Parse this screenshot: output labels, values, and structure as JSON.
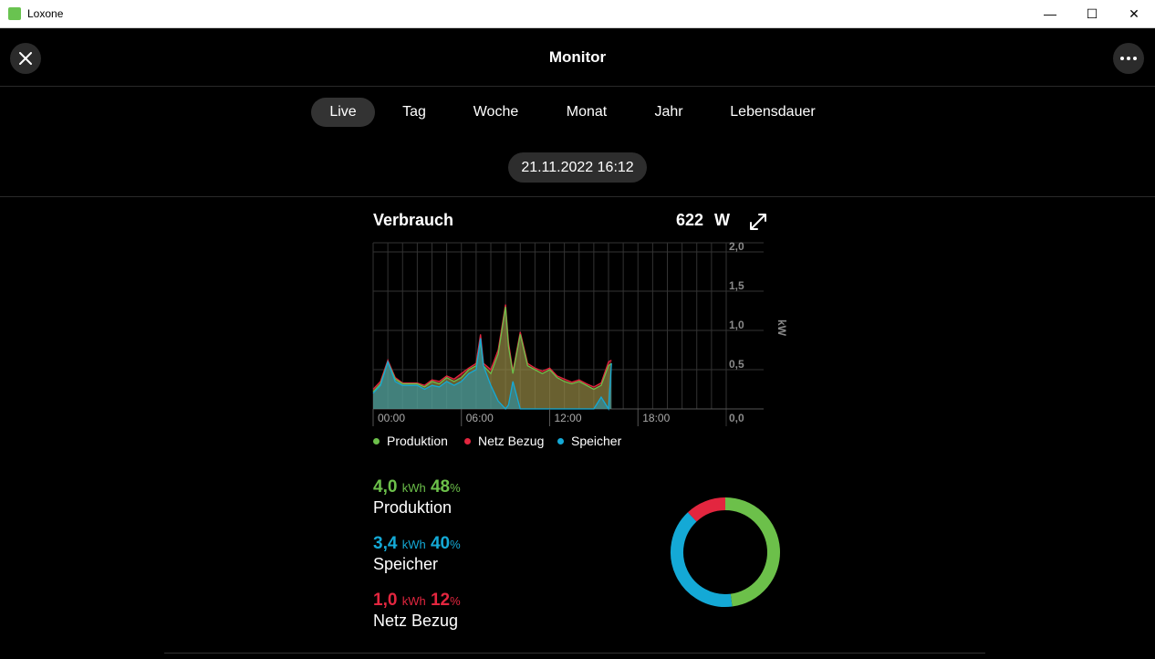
{
  "window": {
    "title": "Loxone",
    "min": "—",
    "max": "☐",
    "close": "✕"
  },
  "header": {
    "title": "Monitor"
  },
  "tabs": [
    {
      "label": "Live",
      "active": true
    },
    {
      "label": "Tag"
    },
    {
      "label": "Woche"
    },
    {
      "label": "Monat"
    },
    {
      "label": "Jahr"
    },
    {
      "label": "Lebensdauer"
    }
  ],
  "date": "21.11.2022 16:12",
  "card": {
    "title": "Verbrauch",
    "value": "622",
    "unit": "W"
  },
  "colors": {
    "produktion": "#6cc04a",
    "netz": "#e3263f",
    "speicher": "#14a9d6",
    "grid": "#333333",
    "axis": "#8a8a8a"
  },
  "chart_data": {
    "type": "area",
    "ylabel": "kW",
    "ylim": [
      0,
      2.0
    ],
    "yticks": [
      "2,0",
      "1,5",
      "1,0",
      "0,5",
      "0,0"
    ],
    "xticks": [
      "00:00",
      "06:00",
      "12:00",
      "18:00"
    ],
    "xlim": [
      0,
      24
    ],
    "series": [
      {
        "name": "Speicher",
        "x": [
          0,
          0.5,
          1,
          1.5,
          2,
          2.5,
          3,
          3.5,
          4,
          4.5,
          5,
          5.5,
          6,
          6.5,
          7,
          7.3,
          7.5,
          8,
          8.5,
          9,
          9.2,
          9.5,
          10,
          10.5,
          11,
          11.5,
          12,
          12.5,
          13,
          13.5,
          14,
          14.5,
          15,
          15.5,
          16,
          16.2
        ],
        "values": [
          0.2,
          0.3,
          0.6,
          0.35,
          0.3,
          0.3,
          0.3,
          0.25,
          0.3,
          0.28,
          0.35,
          0.3,
          0.35,
          0.45,
          0.5,
          0.9,
          0.55,
          0.3,
          0.1,
          0.0,
          0.05,
          0.35,
          0.0,
          0.0,
          0.0,
          0.0,
          0.0,
          0.0,
          0.0,
          0.0,
          0.0,
          0.0,
          0.0,
          0.15,
          0.0,
          0.58
        ]
      },
      {
        "name": "Produktion",
        "x": [
          0,
          0.5,
          1,
          1.5,
          2,
          2.5,
          3,
          3.5,
          4,
          4.5,
          5,
          5.5,
          6,
          6.5,
          7,
          7.3,
          7.5,
          8,
          8.5,
          9,
          9.2,
          9.5,
          10,
          10.5,
          11,
          11.5,
          12,
          12.5,
          13,
          13.5,
          14,
          14.5,
          15,
          15.5,
          16,
          16.2
        ],
        "values": [
          0.22,
          0.32,
          0.6,
          0.38,
          0.32,
          0.32,
          0.32,
          0.28,
          0.35,
          0.32,
          0.4,
          0.35,
          0.4,
          0.5,
          0.55,
          0.85,
          0.55,
          0.45,
          0.7,
          1.3,
          0.8,
          0.45,
          0.95,
          0.55,
          0.5,
          0.45,
          0.5,
          0.4,
          0.35,
          0.32,
          0.35,
          0.3,
          0.25,
          0.3,
          0.55,
          0.58
        ]
      },
      {
        "name": "Netz Bezug",
        "x": [
          0,
          0.5,
          1,
          1.5,
          2,
          2.5,
          3,
          3.5,
          4,
          4.5,
          5,
          5.5,
          6,
          6.5,
          7,
          7.3,
          7.5,
          8,
          8.5,
          9,
          9.2,
          9.5,
          10,
          10.5,
          11,
          11.5,
          12,
          12.5,
          13,
          13.5,
          14,
          14.5,
          15,
          15.5,
          16,
          16.2
        ],
        "values": [
          0.25,
          0.35,
          0.62,
          0.4,
          0.33,
          0.33,
          0.33,
          0.3,
          0.37,
          0.35,
          0.42,
          0.38,
          0.45,
          0.52,
          0.58,
          0.95,
          0.58,
          0.5,
          0.75,
          1.33,
          0.85,
          0.48,
          0.98,
          0.58,
          0.52,
          0.48,
          0.52,
          0.42,
          0.38,
          0.34,
          0.37,
          0.32,
          0.28,
          0.33,
          0.6,
          0.62
        ]
      }
    ]
  },
  "legend": [
    "Produktion",
    "Netz Bezug",
    "Speicher"
  ],
  "stats": [
    {
      "value": "4,0",
      "unit": "kWh",
      "pct_value": "48",
      "pct_sign": "%",
      "label": "Produktion",
      "color": "#6cc04a"
    },
    {
      "value": "3,4",
      "unit": "kWh",
      "pct_value": "40",
      "pct_sign": "%",
      "label": "Speicher",
      "color": "#14a9d6"
    },
    {
      "value": "1,0",
      "unit": "kWh",
      "pct_value": "12",
      "pct_sign": "%",
      "label": "Netz Bezug",
      "color": "#e3263f"
    }
  ],
  "donut": [
    {
      "name": "Produktion",
      "fraction": 0.48
    },
    {
      "name": "Speicher",
      "fraction": 0.4
    },
    {
      "name": "Netz Bezug",
      "fraction": 0.12
    }
  ]
}
